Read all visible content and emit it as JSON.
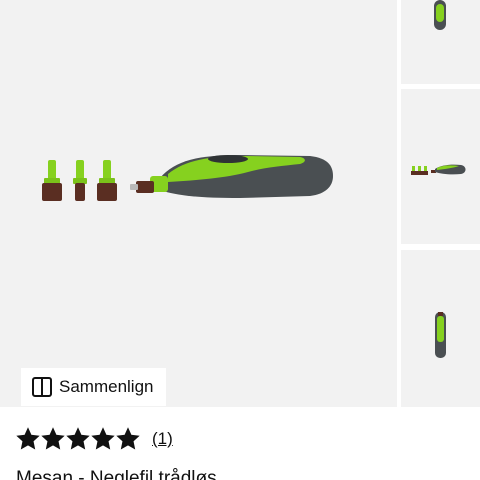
{
  "gallery": {
    "main_image_label": "",
    "thumbnails": [
      {
        "name": "thumb-1"
      },
      {
        "name": "thumb-2"
      },
      {
        "name": "thumb-3"
      }
    ],
    "background_color": "#f2f2f2"
  },
  "compare": {
    "label": "Sammenlign",
    "icon": "compare-columns-icon"
  },
  "rating": {
    "stars": 5,
    "max_stars": 5,
    "review_count": "(1)",
    "star_color": "#111111"
  },
  "product": {
    "title": "Mesan - Neglefil trådløs"
  },
  "colors": {
    "device_green": "#86d11f",
    "device_gray": "#4a4f52",
    "sanding_band": "#5a2e22"
  }
}
